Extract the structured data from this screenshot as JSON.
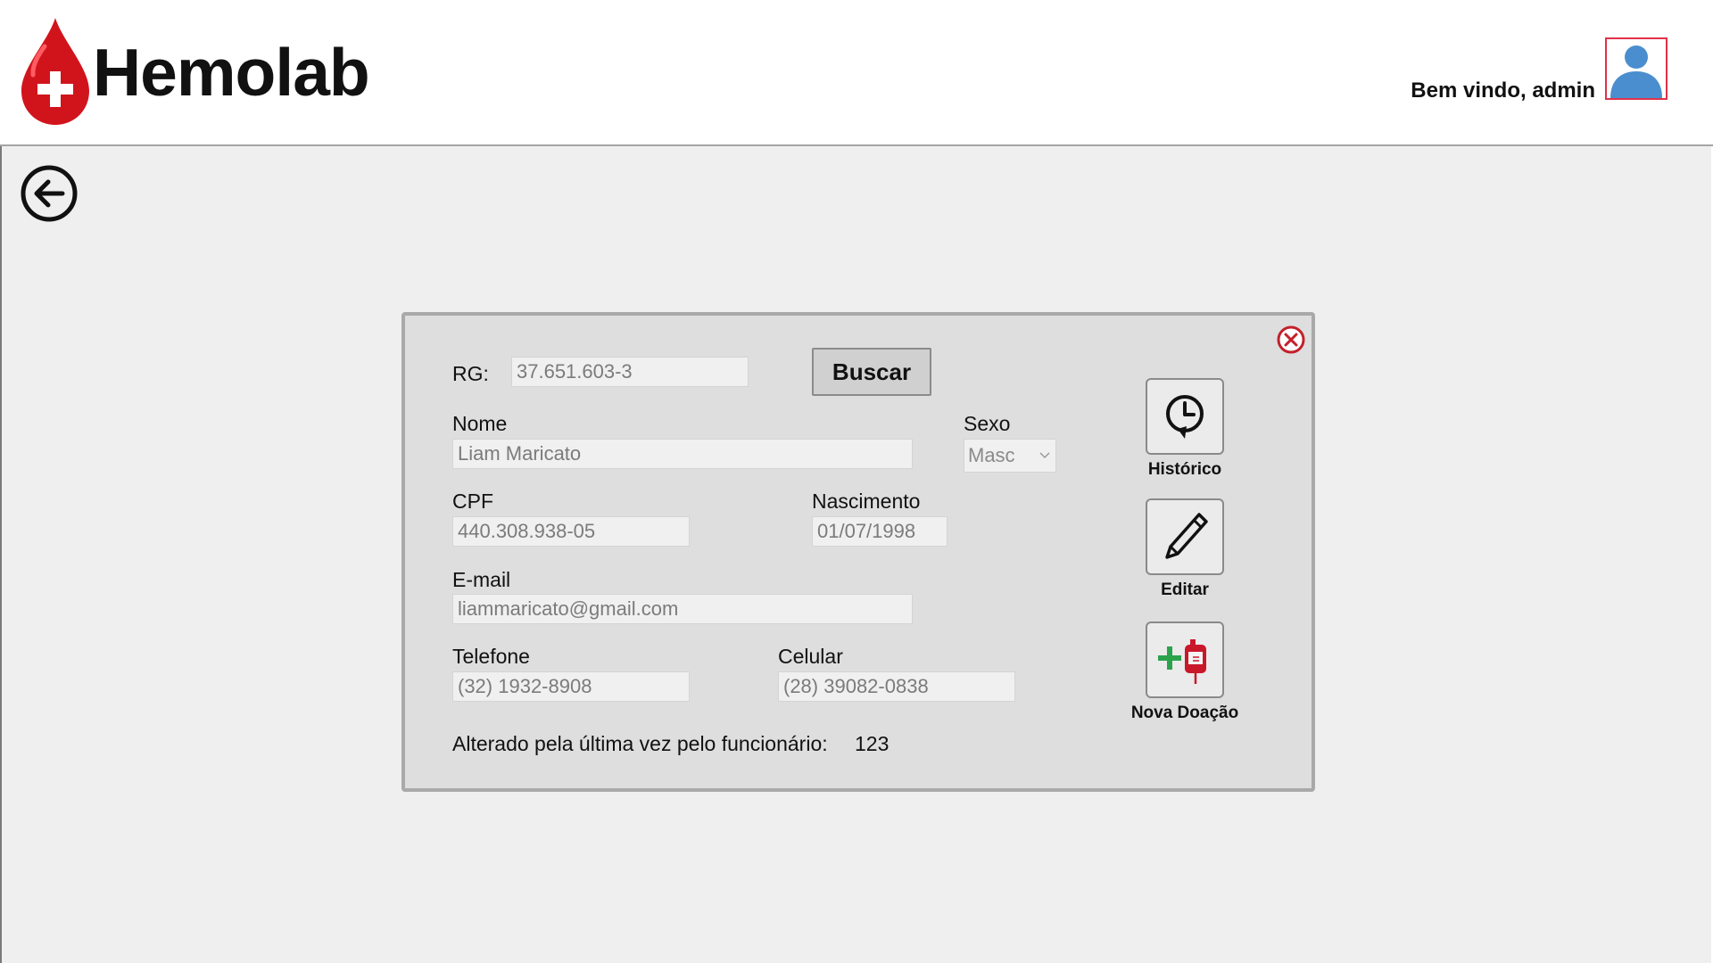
{
  "app": {
    "name": "Hemolab"
  },
  "header": {
    "welcome": "Bem vindo, admin"
  },
  "form": {
    "rg_label": "RG:",
    "rg_value": "37.651.603-3",
    "search_label": "Buscar",
    "name_label": "Nome",
    "name_value": "Liam Maricato",
    "sex_label": "Sexo",
    "sex_value": "Masc",
    "cpf_label": "CPF",
    "cpf_value": "440.308.938-05",
    "birth_label": "Nascimento",
    "birth_value": "01/07/1998",
    "email_label": "E-mail",
    "email_value": "liammaricato@gmail.com",
    "phone_label": "Telefone",
    "phone_value": "(32) 1932-8908",
    "mobile_label": "Celular",
    "mobile_value": "(28) 39082-0838",
    "last_changed_label": "Alterado pela última vez pelo funcionário:",
    "last_changed_value": "123"
  },
  "actions": {
    "history": "Histórico",
    "edit": "Editar",
    "new_donation": "Nova Doação"
  },
  "colors": {
    "brand_red": "#d1141c",
    "avatar_blue": "#4a8ecf",
    "close_red": "#c3202b",
    "plus_green": "#2ba24c"
  }
}
